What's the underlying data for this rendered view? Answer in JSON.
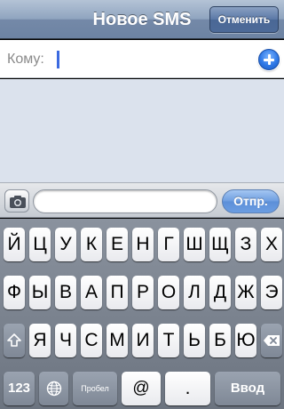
{
  "navbar": {
    "title": "Новое SMS",
    "cancel_label": "Отменить"
  },
  "to_field": {
    "label": "Кому:",
    "value": "",
    "add_icon": "plus-circle-icon"
  },
  "compose": {
    "camera_icon": "camera-icon",
    "message_value": "",
    "send_label": "Отпр."
  },
  "keyboard": {
    "row1": [
      "Й",
      "Ц",
      "У",
      "К",
      "Е",
      "Н",
      "Г",
      "Ш",
      "Щ",
      "З",
      "Х"
    ],
    "row2": [
      "Ф",
      "Ы",
      "В",
      "А",
      "П",
      "Р",
      "О",
      "Л",
      "Д",
      "Ж",
      "Э"
    ],
    "row3": [
      "Я",
      "Ч",
      "С",
      "М",
      "И",
      "Т",
      "Ь",
      "Б",
      "Ю"
    ],
    "shift_icon": "shift-icon",
    "backspace_icon": "backspace-icon",
    "numbers_label": "123",
    "globe_icon": "globe-icon",
    "space_label": "Пробел",
    "at_label": "@",
    "period_label": ".",
    "return_label": "Ввод"
  }
}
